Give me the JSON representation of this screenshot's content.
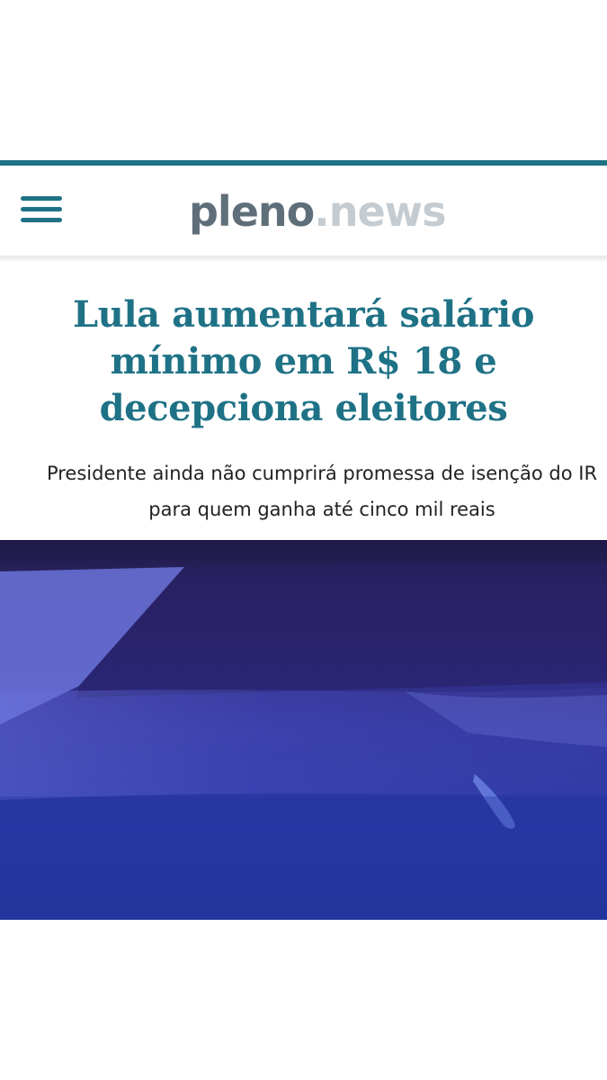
{
  "header": {
    "menu_icon": "hamburger-menu-icon",
    "logo": {
      "part1": "pleno",
      "part2": ".news"
    }
  },
  "article": {
    "headline": "Lula aumentará salário mínimo em R$ 18 e decepciona eleitores",
    "subheadline": "Presidente ainda não cumprirá promessa de isenção do IR para quem ganha até cinco mil reais"
  },
  "colors": {
    "brand_teal": "#1f7286",
    "logo_dark": "#5f6f79",
    "logo_light": "#c4ccd2",
    "image_blue": "#2b38a7"
  }
}
